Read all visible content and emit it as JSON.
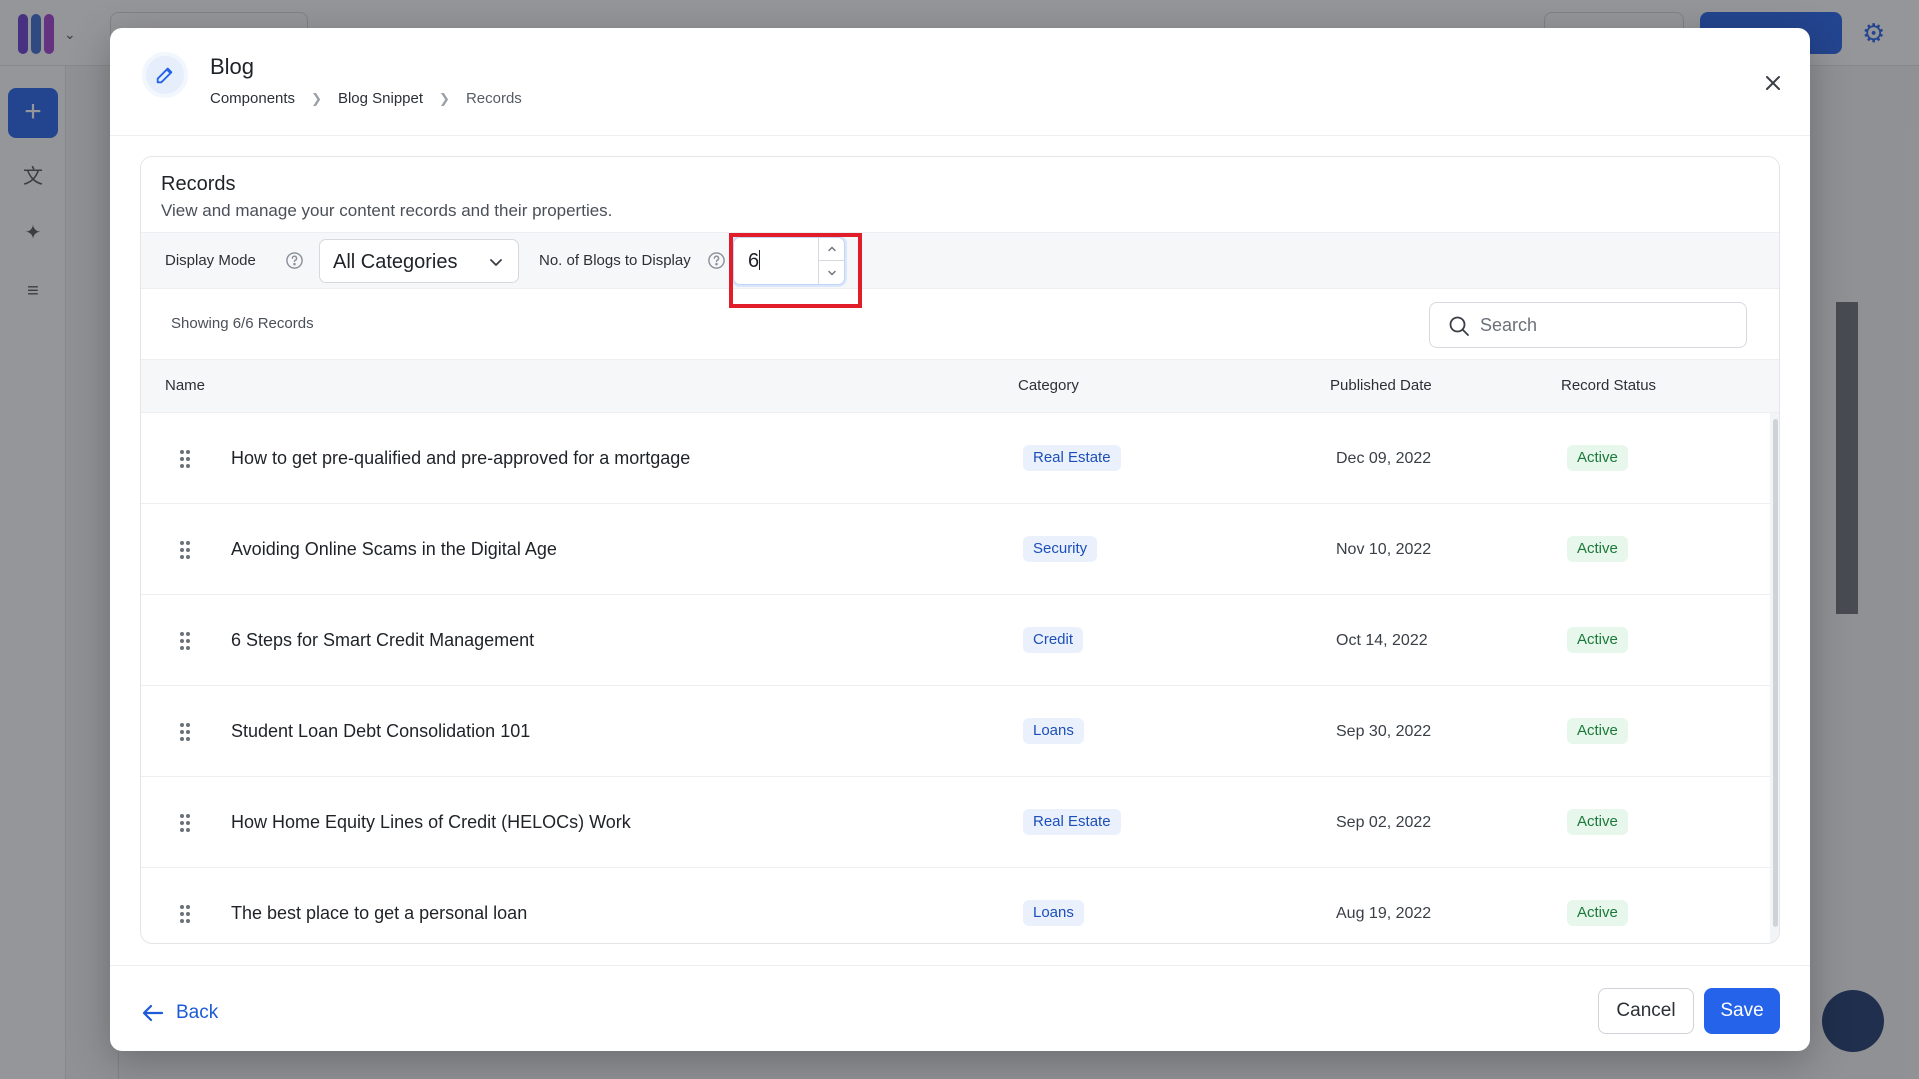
{
  "modal": {
    "title": "Blog",
    "breadcrumb": [
      "Components",
      "Blog Snippet",
      "Records"
    ]
  },
  "card": {
    "title": "Records",
    "description": "View and manage your content records and their properties."
  },
  "toolbar": {
    "display_mode_label": "Display Mode",
    "display_mode_value": "All Categories",
    "blogs_count_label": "No. of Blogs to Display",
    "blogs_count_value": "6"
  },
  "records_count": "Showing 6/6 Records",
  "search": {
    "placeholder": "Search"
  },
  "table": {
    "columns": [
      "Name",
      "Category",
      "Published Date",
      "Record Status"
    ],
    "rows": [
      {
        "name": "How to get pre-qualified and pre-approved for a mortgage",
        "category": "Real Estate",
        "date": "Dec 09, 2022",
        "status": "Active"
      },
      {
        "name": "Avoiding Online Scams in the Digital Age",
        "category": "Security",
        "date": "Nov 10, 2022",
        "status": "Active"
      },
      {
        "name": "6 Steps for Smart Credit Management",
        "category": "Credit",
        "date": "Oct 14, 2022",
        "status": "Active"
      },
      {
        "name": "Student Loan Debt Consolidation 101",
        "category": "Loans",
        "date": "Sep 30, 2022",
        "status": "Active"
      },
      {
        "name": "How Home Equity Lines of Credit (HELOCs) Work",
        "category": "Real Estate",
        "date": "Sep 02, 2022",
        "status": "Active"
      },
      {
        "name": "The best place to get a personal loan",
        "category": "Loans",
        "date": "Aug 19, 2022",
        "status": "Active"
      }
    ]
  },
  "footer": {
    "back_label": "Back",
    "cancel_label": "Cancel",
    "save_label": "Save"
  },
  "colors": {
    "accent": "#2563eb",
    "highlight": "#e11d2a",
    "category_badge_bg": "#eaf1fd",
    "status_badge_bg": "#e8f7ec"
  },
  "icons": {
    "header": "pencil-icon",
    "close": "close-icon",
    "help": "help-circle-icon",
    "select": "chevron-down-icon",
    "spin_up": "chevron-up-icon",
    "spin_down": "chevron-down-icon",
    "search": "search-icon",
    "drag": "drag-handle-icon",
    "back": "arrow-left-icon"
  }
}
